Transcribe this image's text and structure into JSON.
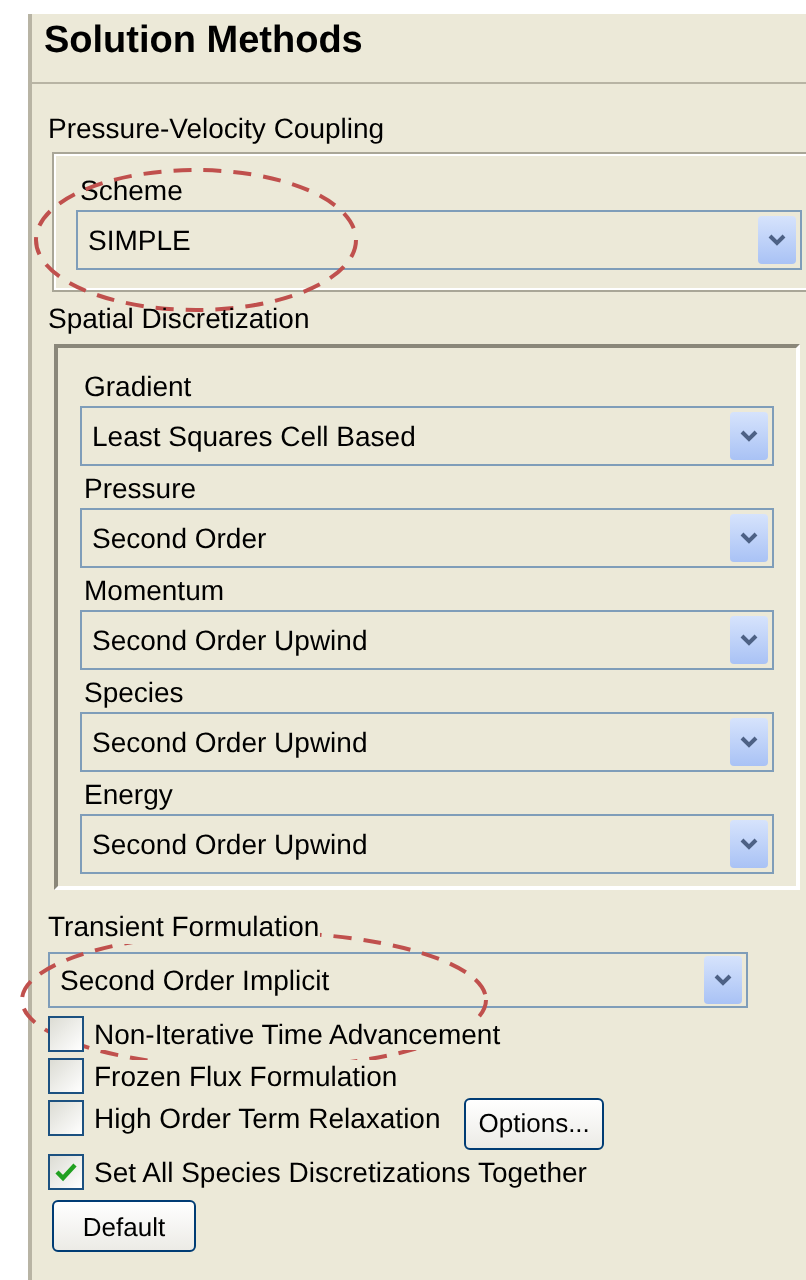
{
  "title": "Solution Methods",
  "pressure_velocity_coupling": {
    "label": "Pressure-Velocity Coupling",
    "scheme": {
      "label": "Scheme",
      "value": "SIMPLE",
      "highlighted": true
    }
  },
  "spatial_discretization": {
    "label": "Spatial Discretization",
    "fields": [
      {
        "label": "Gradient",
        "value": "Least Squares Cell Based"
      },
      {
        "label": "Pressure",
        "value": "Second Order"
      },
      {
        "label": "Momentum",
        "value": "Second Order Upwind"
      },
      {
        "label": "Species",
        "value": "Second Order Upwind"
      },
      {
        "label": "Energy",
        "value": "Second Order Upwind"
      }
    ]
  },
  "transient_formulation": {
    "label": "Transient Formulation",
    "value": "Second Order Implicit",
    "highlighted": true
  },
  "options": [
    {
      "label": "Non-Iterative Time Advancement",
      "checked": false
    },
    {
      "label": "Frozen Flux Formulation",
      "checked": false
    },
    {
      "label": "High Order Term Relaxation",
      "checked": false,
      "button": "Options..."
    },
    {
      "label": "Set All Species Discretizations Together",
      "checked": true
    }
  ],
  "default_button": "Default"
}
